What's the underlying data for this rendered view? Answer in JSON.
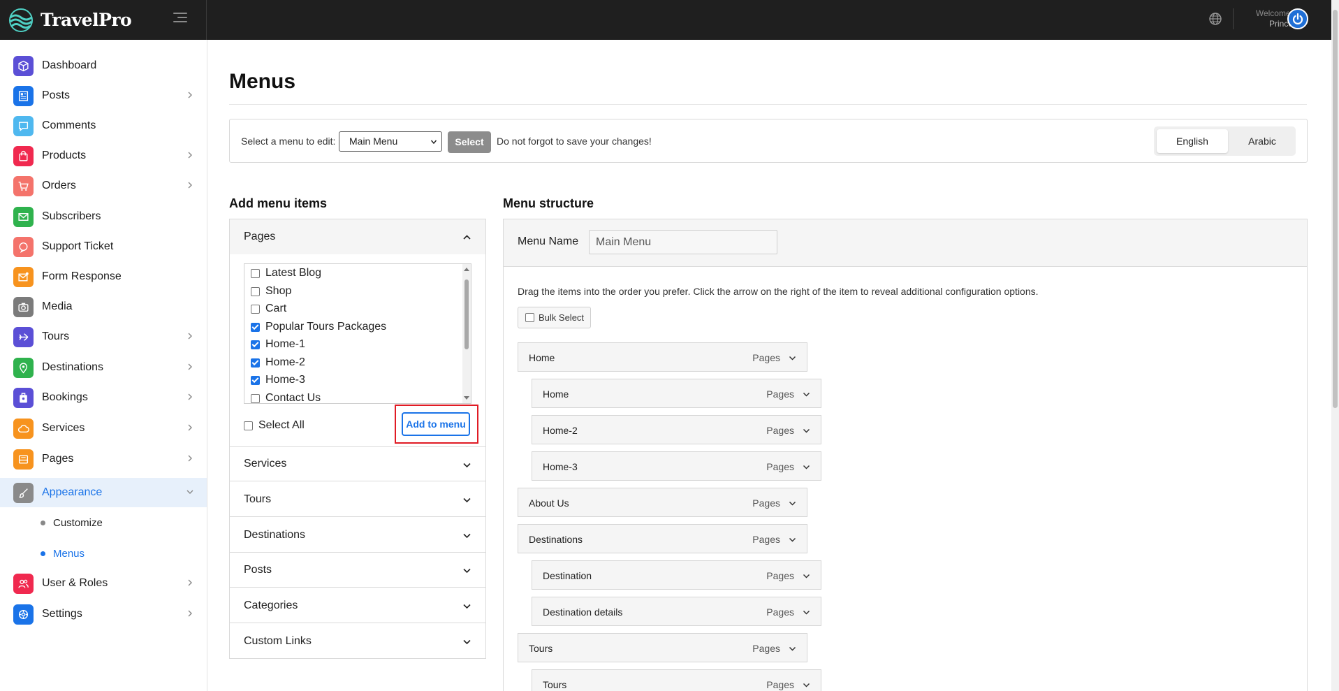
{
  "brand": {
    "name": "TravelPro"
  },
  "header": {
    "welcome": "Welcome,",
    "user": "Prince"
  },
  "sidebar": {
    "items": [
      {
        "label": "Dashboard",
        "icon": "cube-icon",
        "color": "#5b4fd6"
      },
      {
        "label": "Posts",
        "icon": "newspaper-icon",
        "color": "#1a73e8"
      },
      {
        "label": "Comments",
        "icon": "chat-icon",
        "color": "#4fb8ef"
      },
      {
        "label": "Products",
        "icon": "bag-icon",
        "color": "#f0294f"
      },
      {
        "label": "Orders",
        "icon": "cart-icon",
        "color": "#f4736b"
      },
      {
        "label": "Subscribers",
        "icon": "envelope-icon",
        "color": "#2fb24d"
      },
      {
        "label": "Support Ticket",
        "icon": "support-icon",
        "color": "#f4736b"
      },
      {
        "label": "Form Response",
        "icon": "mail-icon",
        "color": "#f7931e"
      },
      {
        "label": "Media",
        "icon": "camera-icon",
        "color": "#7b7b7b"
      },
      {
        "label": "Tours",
        "icon": "plane-icon",
        "color": "#5b4fd6"
      },
      {
        "label": "Destinations",
        "icon": "pin-icon",
        "color": "#2fb24d"
      },
      {
        "label": "Bookings",
        "icon": "booking-icon",
        "color": "#5b4fd6"
      },
      {
        "label": "Services",
        "icon": "cloud-icon",
        "color": "#f7931e"
      },
      {
        "label": "Pages",
        "icon": "pages-icon",
        "color": "#f7931e"
      },
      {
        "label": "Appearance",
        "icon": "brush-icon",
        "color": "#8a8a8a"
      },
      {
        "label": "User & Roles",
        "icon": "users-icon",
        "color": "#f0294f"
      },
      {
        "label": "Settings",
        "icon": "gear-icon",
        "color": "#1a73e8"
      }
    ],
    "sub_items": [
      {
        "label": "Customize"
      },
      {
        "label": "Menus"
      }
    ]
  },
  "page": {
    "title": "Menus"
  },
  "select_bar": {
    "label": "Select a menu to edit:",
    "selected_menu": "Main Menu",
    "select_button": "Select",
    "note": "Do not forgot to save your changes!",
    "languages": [
      "English",
      "Arabic"
    ],
    "active_language": "English"
  },
  "add_menu_items": {
    "heading": "Add menu items",
    "sections": [
      "Pages",
      "Services",
      "Tours",
      "Destinations",
      "Posts",
      "Categories",
      "Custom Links"
    ],
    "pages": [
      {
        "label": "Latest Blog",
        "checked": false
      },
      {
        "label": "Shop",
        "checked": false
      },
      {
        "label": "Cart",
        "checked": false
      },
      {
        "label": "Popular Tours Packages",
        "checked": true
      },
      {
        "label": "Home-1",
        "checked": true
      },
      {
        "label": "Home-2",
        "checked": true
      },
      {
        "label": "Home-3",
        "checked": true
      },
      {
        "label": "Contact Us",
        "checked": false
      }
    ],
    "select_all": "Select All",
    "add_button": "Add to menu"
  },
  "menu_structure": {
    "heading": "Menu structure",
    "name_label": "Menu Name",
    "name_value": "Main Menu",
    "hint": "Drag the items into the order you prefer. Click the arrow on the right of the item to reveal additional configuration options.",
    "bulk_select": "Bulk Select",
    "items": [
      {
        "title": "Home",
        "kind": "Pages",
        "level": 0
      },
      {
        "title": "Home",
        "kind": "Pages",
        "level": 1
      },
      {
        "title": "Home-2",
        "kind": "Pages",
        "level": 1
      },
      {
        "title": "Home-3",
        "kind": "Pages",
        "level": 1
      },
      {
        "title": "About Us",
        "kind": "Pages",
        "level": 0
      },
      {
        "title": "Destinations",
        "kind": "Pages",
        "level": 0
      },
      {
        "title": "Destination",
        "kind": "Pages",
        "level": 1
      },
      {
        "title": "Destination details",
        "kind": "Pages",
        "level": 1
      },
      {
        "title": "Tours",
        "kind": "Pages",
        "level": 0
      },
      {
        "title": "Tours",
        "kind": "Pages",
        "level": 1
      }
    ]
  }
}
